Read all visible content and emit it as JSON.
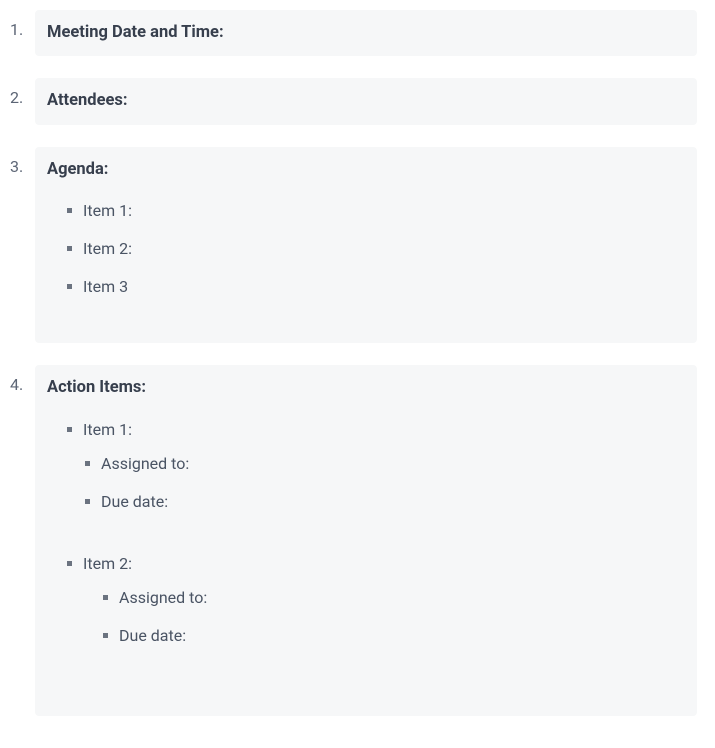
{
  "sections": {
    "meeting_date": {
      "label": "Meeting Date and Time:"
    },
    "attendees": {
      "label": "Attendees:"
    },
    "agenda": {
      "label": "Agenda:",
      "items": [
        "Item 1:",
        "Item 2:",
        "Item 3"
      ]
    },
    "action_items": {
      "label": "Action Items:",
      "items": [
        {
          "title": "Item 1:",
          "assigned_to_label": "Assigned to:",
          "due_date_label": "Due date:"
        },
        {
          "title": "Item 2:",
          "assigned_to_label": "Assigned to:",
          "due_date_label": "Due date:"
        }
      ]
    }
  }
}
